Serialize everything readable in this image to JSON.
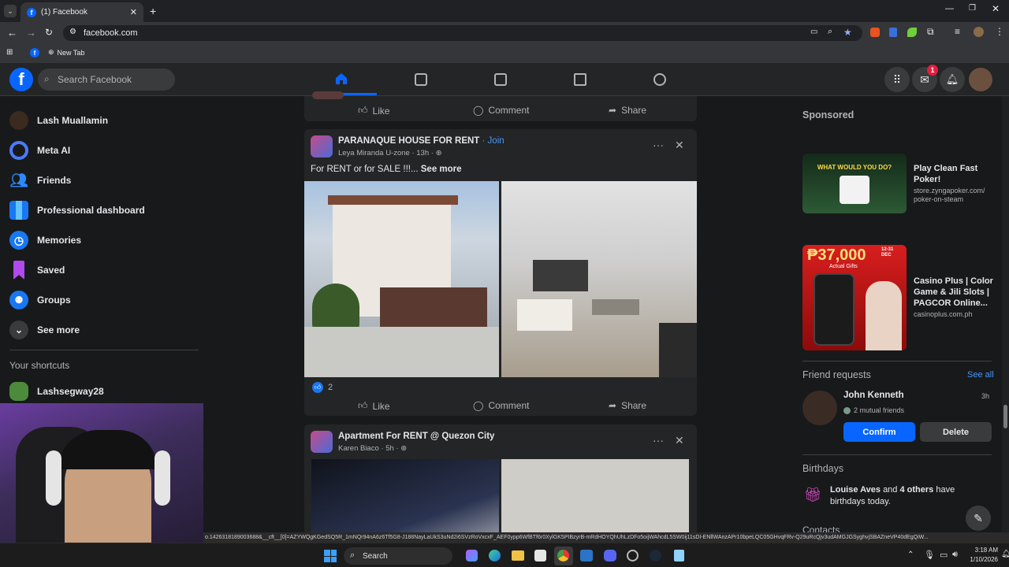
{
  "browser": {
    "tab_title": "(1) Facebook",
    "url": "facebook.com",
    "bookmark": "New Tab"
  },
  "nav": {
    "search_placeholder": "Search Facebook",
    "messenger_badge": "1"
  },
  "sidebar": {
    "items": [
      {
        "label": "Lash Muallamin",
        "icon": "avatar"
      },
      {
        "label": "Meta AI",
        "icon": "meta-ai-icon"
      },
      {
        "label": "Friends",
        "icon": "friends-icon"
      },
      {
        "label": "Professional dashboard",
        "icon": "dashboard-icon"
      },
      {
        "label": "Memories",
        "icon": "clock-icon"
      },
      {
        "label": "Saved",
        "icon": "bookmark-icon"
      },
      {
        "label": "Groups",
        "icon": "groups-icon"
      },
      {
        "label": "See more",
        "icon": "chevron-down-icon"
      }
    ],
    "shortcuts_title": "Your shortcuts",
    "shortcut": "Lashsegway28"
  },
  "feed": {
    "prev_post": {
      "like": "Like",
      "comment": "Comment",
      "share": "Share"
    },
    "post1": {
      "group": "PARANAQUE HOUSE FOR RENT",
      "join": "· Join",
      "author": "Leya Miranda U-zone",
      "time": "· 13h ·",
      "text": "For RENT or for SALE !!!...",
      "see_more": "See more",
      "reactions": "2",
      "like": "Like",
      "comment": "Comment",
      "share": "Share"
    },
    "post2": {
      "group": "Apartment For RENT @ Quezon City",
      "author": "Karen Biaco",
      "time": "· 5h ·"
    }
  },
  "right": {
    "sponsored": "Sponsored",
    "ads": [
      {
        "title": "Play Clean Fast Poker!",
        "url": "store.zyngapoker.com/ poker-on-steam",
        "banner": "WHAT WOULD YOU DO?"
      },
      {
        "title": "Casino Plus | Color Game & Jili Slots | PAGCOR Online...",
        "url": "casinoplus.com.ph",
        "banner": "₱37,000",
        "banner_sub": "Actual Gifts",
        "banner_date": "12-31 DEC"
      }
    ],
    "friend_requests": "Friend requests",
    "see_all": "See all",
    "request": {
      "name": "John Kenneth",
      "mutual": "2 mutual friends",
      "time": "3h",
      "confirm": "Confirm",
      "delete": "Delete"
    },
    "birthdays": "Birthdays",
    "birthday_name": "Louise Aves",
    "birthday_and": "and",
    "birthday_others": "4 others",
    "birthday_rest": "have birthdays today.",
    "contacts": "Contacts"
  },
  "status_url": "o.1426318189003688&__cft__[0]=AZYWQgKGedSQ5R_1mNQr94nA6z6Tf5G8-J188NayLaUkS3uNd2i6SVzRoVxcxF_AEF0ypp6WfBTf6r0XylGK5PIBzyrB-mRdHOYQhUhLzDFo5oijWAhcdL5SW0ij11sDI-ENllWAnzAPr10bpeLQC05GHvqFRv-Q29uRcQjv3udAMGJGSyghvjSBAZneVP40dEgQiW...",
  "taskbar": {
    "search": "Search",
    "time": "3:18 AM",
    "date": "1/10/2026"
  },
  "colors": {
    "accent": "#0866ff",
    "link": "#4599ff",
    "bg": "#18191a",
    "card": "#242526"
  }
}
